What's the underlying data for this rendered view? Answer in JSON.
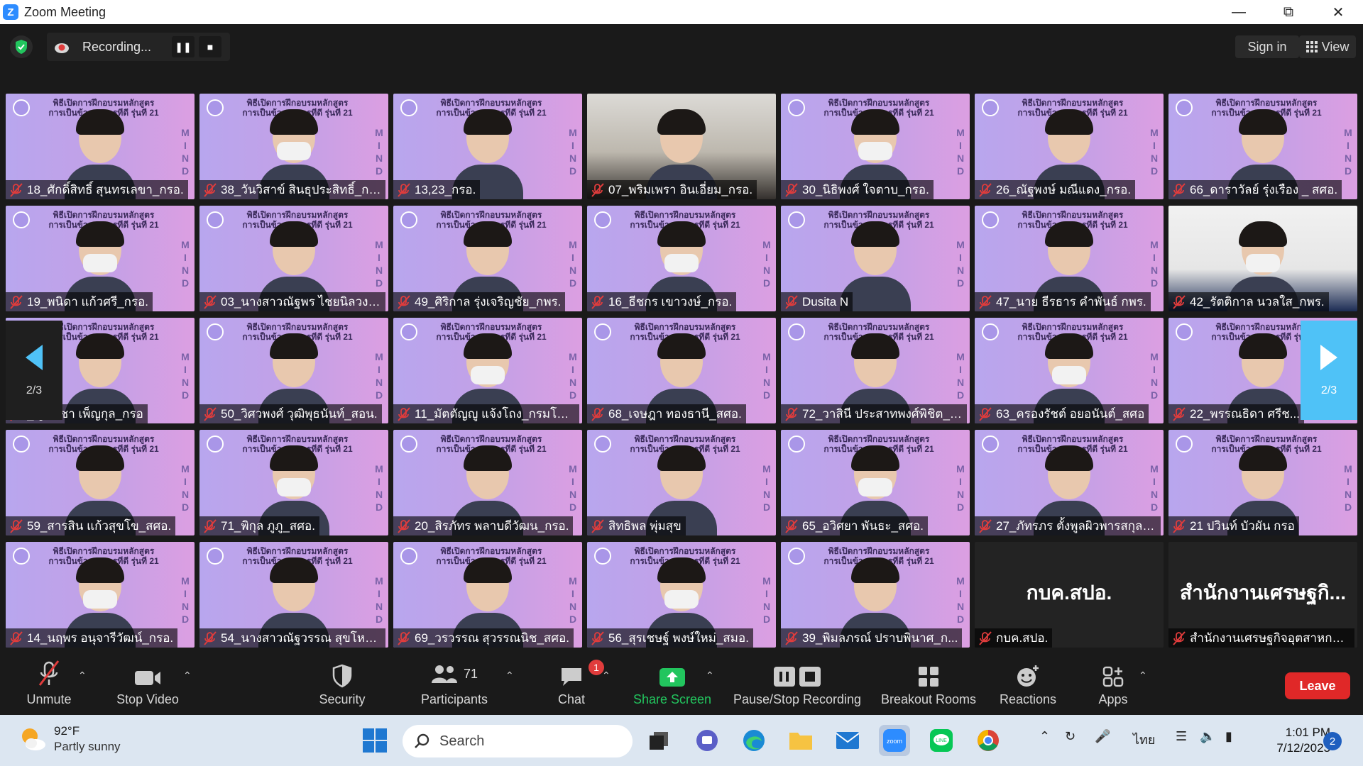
{
  "window": {
    "title": "Zoom Meeting",
    "controls": [
      "minimize",
      "restore",
      "close"
    ]
  },
  "topbar": {
    "recording_label": "Recording...",
    "sign_in": "Sign in",
    "view": "View"
  },
  "banner": {
    "line1": "พิธีเปิดการฝึกอบรมหลักสูตร",
    "line2": "การเป็นข้าราชการที่ดี รุ่นที่ 21",
    "side": [
      "M",
      "I",
      "N",
      "D"
    ]
  },
  "pagination": {
    "left_page": "2/3",
    "right_page": "2/3"
  },
  "participants": [
    {
      "name": "18_ศักดิ์สิทธิ์ สุนทรเลขา_กรอ.",
      "type": "video"
    },
    {
      "name": "38_วันวิสาข์ สินธุประสิทธิ์_กพร.",
      "type": "video"
    },
    {
      "name": "13,23_กรอ.",
      "type": "video"
    },
    {
      "name": "07_พริมเพรา อินเอี่ยม_กรอ.",
      "type": "camera"
    },
    {
      "name": "30_นิธิพงศ์ ใจตาบ_กรอ.",
      "type": "video"
    },
    {
      "name": "26_ณัฐพงษ์ มณีแดง_กรอ.",
      "type": "video"
    },
    {
      "name": "66_ดาราวัลย์ รุ่งเรือง _ สศอ.",
      "type": "video"
    },
    {
      "name": "19_พนิดา แก้วศรี_กรอ.",
      "type": "video"
    },
    {
      "name": "03_นางสาวณัฐพร ไชยนิลวงศ์...",
      "type": "video"
    },
    {
      "name": "49_ศิริกาล รุ่งเจริญชัย_กพร.",
      "type": "video"
    },
    {
      "name": "16_ธีชกร เขาวงษ์_กรอ.",
      "type": "video"
    },
    {
      "name": "Dusita N",
      "type": "video"
    },
    {
      "name": "47_นาย ธีรธาร คำพันธ์ กพร.",
      "type": "video"
    },
    {
      "name": "42_รัตติกาล นวลใส_กพร.",
      "type": "photo"
    },
    {
      "name": "_ญพิชชา เพ็ญกุล_กรอ",
      "type": "video"
    },
    {
      "name": "50_วิศวพงศ์ วุฒิพุธนันท์_สอน.",
      "type": "video"
    },
    {
      "name": "11_มัตตัญญู แจ้งโถง_กรมโรงง...",
      "type": "video"
    },
    {
      "name": "68_เจษฎา ทองธานี_สศอ.",
      "type": "video"
    },
    {
      "name": "72_วาสินี ประสาทพงศ์พิชิต_ส...",
      "type": "video"
    },
    {
      "name": "63_ครองรัชต์ อยอนันต์_สศอ",
      "type": "video"
    },
    {
      "name": "22_พรรณธิดา ศรีช...",
      "type": "video"
    },
    {
      "name": "59_สารสิน แก้วสุขโข_สศอ.",
      "type": "video"
    },
    {
      "name": "71_พิกุล ภูภู_สศอ.",
      "type": "video"
    },
    {
      "name": "20_สิรภัทร พลาบดีวัฒน_กรอ.",
      "type": "video"
    },
    {
      "name": "สิทธิพล พุ่มสุข",
      "type": "video"
    },
    {
      "name": "65_อวิศยา พันธะ_สศอ.",
      "type": "video"
    },
    {
      "name": "27_ภัทรภร ตั้งพูลผิวพารสกุล_...",
      "type": "video"
    },
    {
      "name": "21 ปวินท์ บัวผัน กรอ",
      "type": "video"
    },
    {
      "name": "14_นฤพร อนุจารีวัฒน์_กรอ.",
      "type": "video"
    },
    {
      "name": "54_นางสาวณัฐวรรณ สุขโหต_...",
      "type": "video"
    },
    {
      "name": "69_วรวรรณ สุวรรณนิช_สศอ.",
      "type": "video"
    },
    {
      "name": "56_สุรเชษฐ์ พงษ์ใหม่_สมอ.",
      "type": "video"
    },
    {
      "name": "39_พิมลภรณ์ ปราบพินาศ_ก...",
      "type": "video"
    },
    {
      "name": "กบค.สปอ.",
      "type": "dark",
      "display": "กบค.สปอ."
    },
    {
      "name": "สำนักงานเศรษฐกิจอุตสาหกรรม",
      "type": "dark",
      "display": "สำนักงานเศรษฐกิ..."
    }
  ],
  "toolbar": {
    "unmute": "Unmute",
    "stop_video": "Stop Video",
    "security": "Security",
    "participants": "Participants",
    "participants_count": "71",
    "chat": "Chat",
    "chat_badge": "1",
    "share_screen": "Share Screen",
    "pause_stop_recording": "Pause/Stop Recording",
    "breakout_rooms": "Breakout Rooms",
    "reactions": "Reactions",
    "apps": "Apps",
    "leave": "Leave"
  },
  "taskbar": {
    "temperature": "92°F",
    "weather": "Partly sunny",
    "search_placeholder": "Search",
    "language": "ไทย",
    "time": "1:01 PM",
    "date": "7/12/2023",
    "notifications": "2"
  },
  "colors": {
    "zoom_blue": "#2d8cff",
    "share_green": "#22c55e",
    "leave_red": "#e02828",
    "muted_red": "#e03c3c",
    "next_arrow": "#4fc2f7"
  }
}
